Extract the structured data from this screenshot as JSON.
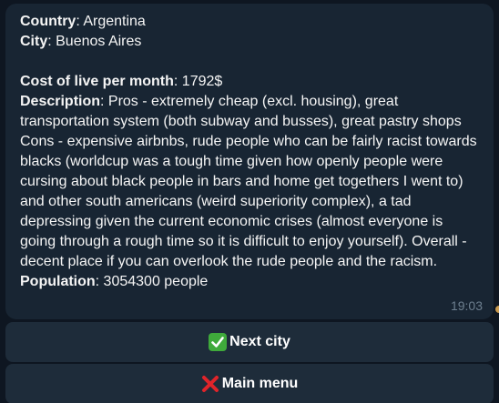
{
  "message": {
    "country_label": "Country",
    "country_value": ": Argentina",
    "city_label": "City",
    "city_value": ": Buenos Aires",
    "cost_label": "Cost of live per month",
    "cost_value": ": 1792$",
    "description_label": "Description",
    "description_value": ": Pros - extremely cheap (excl. housing), great transportation system (both subway and busses), great pastry shops Cons - expensive airbnbs, rude people who can be fairly racist towards blacks (worldcup was a tough time given how openly people were cursing about black people in bars and home get togethers I went to)  and other south americans (weird superiority complex), a tad depressing given the current economic crises (almost everyone is going through a rough time so it is difficult to enjoy yourself). Overall - decent place if you can overlook the rude people and the racism.",
    "population_label": "Population",
    "population_value": ": 3054300 people",
    "time": "19:03"
  },
  "keyboard": {
    "next_label": "Next city",
    "next_icon": "check-mark-icon",
    "menu_label": "Main menu",
    "menu_icon": "cross-mark-icon"
  },
  "colors": {
    "background": "#0e1621",
    "bubble": "#182533",
    "button": "#1e2c3a",
    "check": "#3faa3b",
    "cross": "#e0242a"
  }
}
